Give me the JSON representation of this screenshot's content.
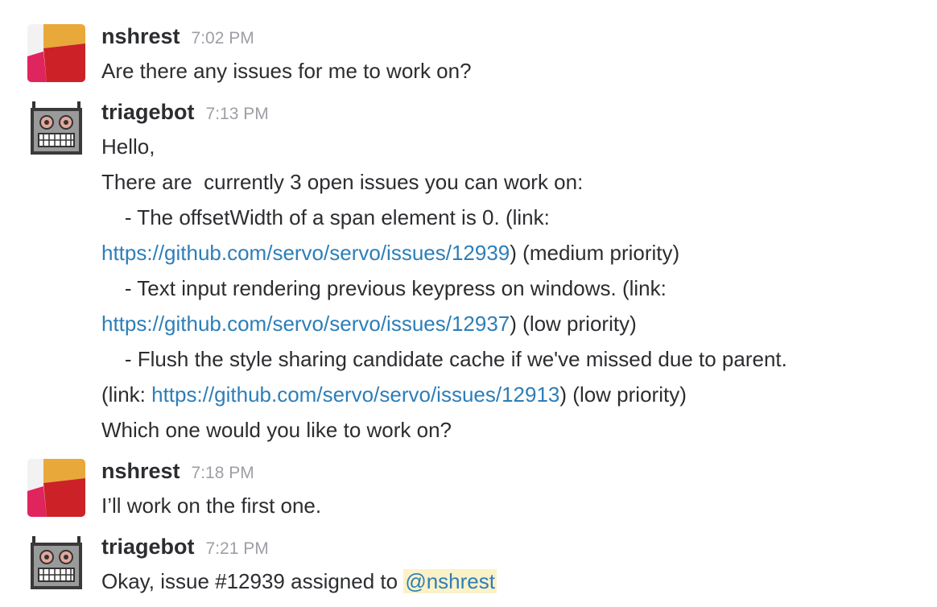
{
  "messages": [
    {
      "author": "nshrest",
      "time": "7:02 PM",
      "text": "Are there any issues for me to work on?"
    },
    {
      "author": "triagebot",
      "time": "7:13 PM",
      "greeting": "Hello,",
      "intro": "There are  currently 3 open issues you can work on:",
      "issues": [
        {
          "title": "    - The offsetWidth of a span element is 0. (link:",
          "link_prefix": "",
          "url": "https://github.com/servo/servo/issues/12939",
          "priority": ") (medium priority)"
        },
        {
          "title": "    - Text input rendering previous keypress on windows. (link:",
          "link_prefix": "",
          "url": "https://github.com/servo/servo/issues/12937",
          "priority": ") (low priority)"
        },
        {
          "title": "    - Flush the style sharing candidate cache if we've missed due to parent.",
          "link_prefix": "(link: ",
          "url": "https://github.com/servo/servo/issues/12913",
          "priority": ") (low priority)"
        }
      ],
      "question": "Which one would you like to work on?"
    },
    {
      "author": "nshrest",
      "time": "7:18 PM",
      "text": "I’ll work on the first one."
    },
    {
      "author": "triagebot",
      "time": "7:21 PM",
      "text": "Okay, issue #12939 assigned to ",
      "mention": "@nshrest"
    }
  ],
  "colors": {
    "text": "#2c2d30",
    "timestamp": "#9e9ea6",
    "link": "#2d7eb8",
    "mention_bg": "#fbf2c8"
  },
  "icons": {
    "nshrest_avatar": "slack-default-avatar",
    "triagebot_avatar": "robot-avatar"
  }
}
